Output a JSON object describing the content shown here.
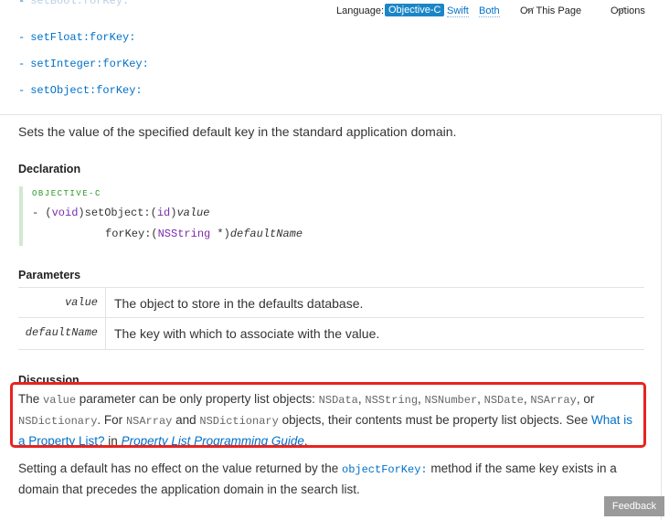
{
  "toolbar": {
    "language_label": "Language:",
    "lang_objc": "Objective-C",
    "lang_swift": "Swift",
    "lang_both": "Both",
    "on_this_page": "On This Page",
    "options": "Options"
  },
  "methods": [
    "setBool:forKey:",
    "setFloat:forKey:",
    "setInteger:forKey:",
    "setObject:forKey:"
  ],
  "summary": "Sets the value of the specified default key in the standard application domain.",
  "declaration": {
    "heading": "Declaration",
    "language": "OBJECTIVE-C",
    "line1": {
      "a": "- (",
      "b": "void",
      "c": ")setObject:(",
      "d": "id",
      "e": ")",
      "f": "value"
    },
    "line2": {
      "a": "forKey:(",
      "b": "NSString",
      "c": " *)",
      "d": "defaultName"
    }
  },
  "parameters": {
    "heading": "Parameters",
    "rows": [
      {
        "name": "value",
        "desc": "The object to store in the defaults database."
      },
      {
        "name": "defaultName",
        "desc": "The key with which to associate with the value."
      }
    ]
  },
  "discussion": {
    "heading": "Discussion",
    "t1": "The ",
    "c1": "value",
    "t2": " parameter can be only property list objects: ",
    "c2": "NSData",
    "t3": ", ",
    "c3": "NSString",
    "t4": ", ",
    "c4": "NSNumber",
    "t5": ", ",
    "c5": "NSDate",
    "t6": ", ",
    "c6": "NSArray",
    "t7": ", or ",
    "c7": "NSDictionary",
    "t8": ". For ",
    "c8": "NSArray",
    "t9": " and ",
    "c9": "NSDictionary",
    "t10": " objects, their contents must be property list objects. See ",
    "link1": "What is a Property List?",
    "t11": " in ",
    "link2": "Property List Programming Guide",
    "t12": "."
  },
  "second_para": {
    "t1": "Setting a default has no effect on the value returned by the ",
    "code": "objectForKey:",
    "t2": " method if the same key exists in a domain that precedes the application domain in the search list."
  },
  "feedback": "Feedback"
}
